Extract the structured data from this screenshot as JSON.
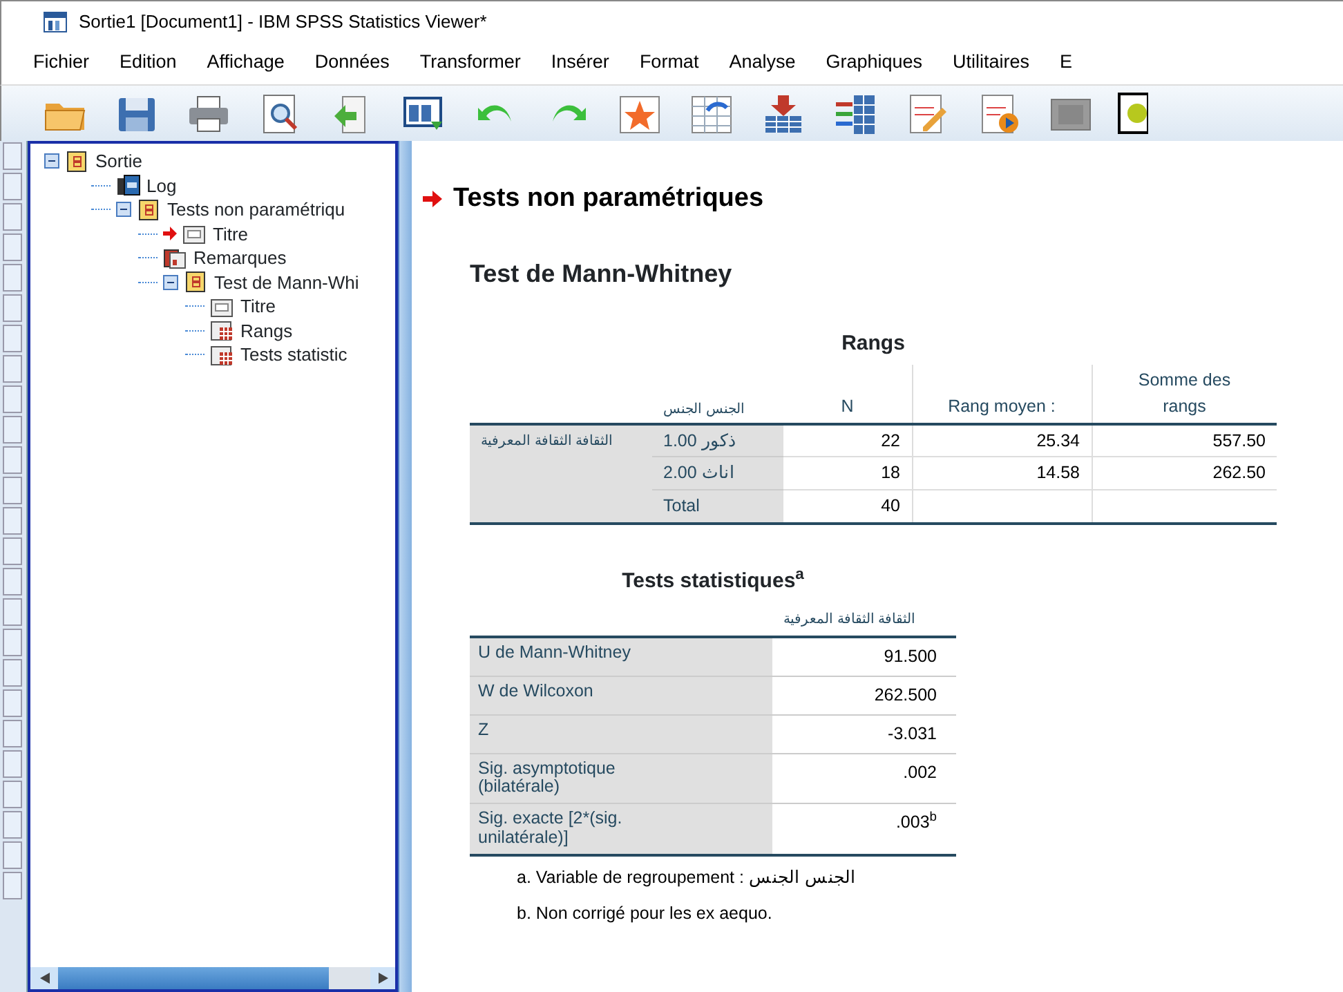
{
  "window": {
    "title": "Sortie1 [Document1] - IBM SPSS Statistics Viewer*"
  },
  "menu": [
    "Fichier",
    "Edition",
    "Affichage",
    "Données",
    "Transformer",
    "Insérer",
    "Format",
    "Analyse",
    "Graphiques",
    "Utilitaires",
    "E"
  ],
  "outline": [
    {
      "label": "Sortie",
      "kind": "book",
      "expanded": true,
      "current": false,
      "children": [
        {
          "label": "Log",
          "kind": "log",
          "current": false
        },
        {
          "label": "Tests non paramétriqu",
          "kind": "book",
          "expanded": true,
          "current": false,
          "children": [
            {
              "label": "Titre",
              "kind": "title",
              "current": true
            },
            {
              "label": "Remarques",
              "kind": "notes",
              "current": false
            },
            {
              "label": "Test de Mann-Whi",
              "kind": "book",
              "expanded": true,
              "current": false,
              "children": [
                {
                  "label": "Titre",
                  "kind": "title",
                  "current": false
                },
                {
                  "label": "Rangs",
                  "kind": "table",
                  "current": false
                },
                {
                  "label": "Tests statistic",
                  "kind": "table",
                  "current": false
                }
              ]
            }
          ]
        }
      ]
    }
  ],
  "content": {
    "heading": "Tests non paramétriques",
    "current": true,
    "subheading": "Test de Mann-Whitney",
    "ranks": {
      "title": "Rangs",
      "columns": [
        "الجنس الجنس",
        "N",
        "Rang moyen :",
        "Somme des rangs"
      ],
      "group": "الثقافة الثقافة المعرفية",
      "rows": [
        {
          "label": "1.00 ذكور",
          "n": "22",
          "mean": "25.34",
          "sum": "557.50"
        },
        {
          "label": "2.00 اناث",
          "n": "18",
          "mean": "14.58",
          "sum": "262.50"
        },
        {
          "label": "Total",
          "n": "40"
        }
      ]
    },
    "stats": {
      "title": "Tests statistiques$^{a}$",
      "column": "الثقافة الثقافة المعرفية",
      "rows": [
        {
          "label": "U de Mann-Whitney",
          "value": "91.500"
        },
        {
          "label": "W de Wilcoxon",
          "value": "262.500"
        },
        {
          "label": "Z",
          "value": "-3.031"
        },
        {
          "label": "Sig. asymptotique (bilatérale)",
          "value": ".002"
        },
        {
          "label": "Sig. exacte [2*(sig. unilatérale)]",
          "value": ".003$^{b}$"
        }
      ],
      "footnotes": [
        "a. Variable de regroupement : الجنس الجنس",
        "b. Non corrigé pour les ex aequo."
      ]
    }
  }
}
